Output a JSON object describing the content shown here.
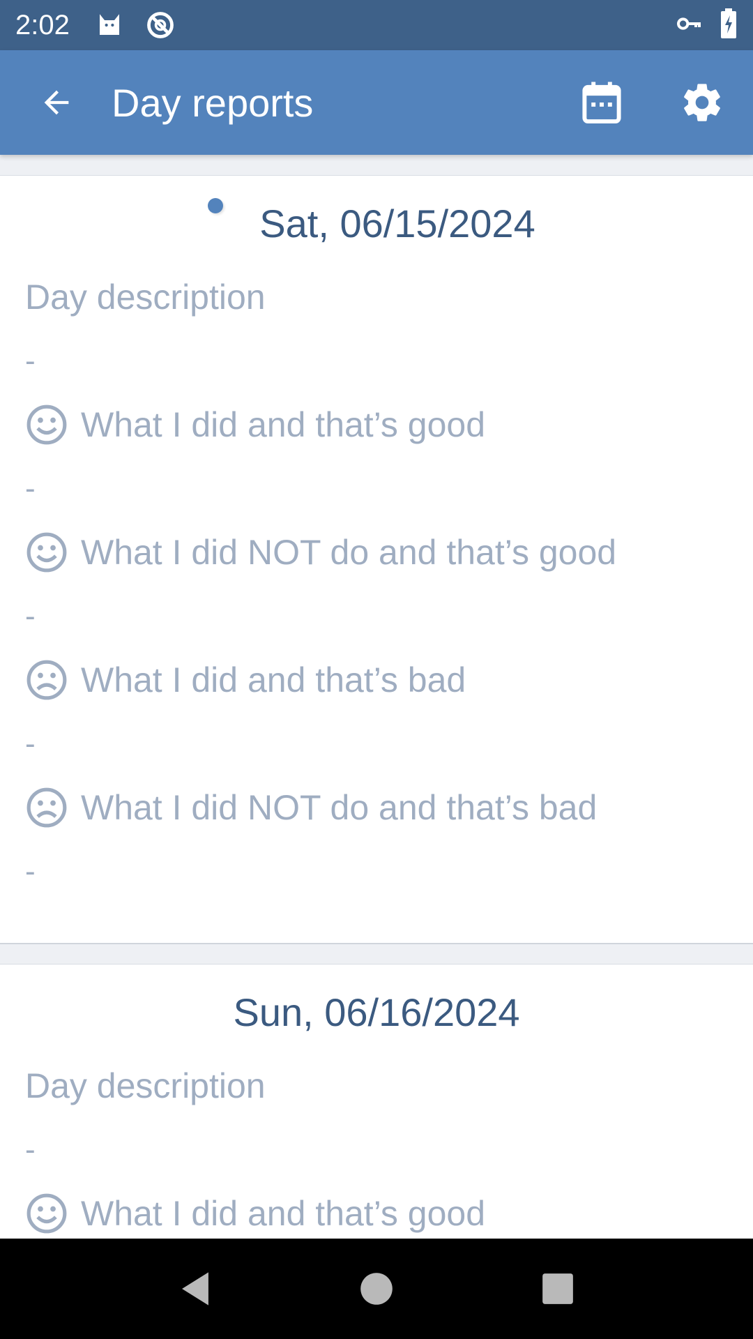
{
  "status_bar": {
    "time": "2:02",
    "icons": [
      "cat-icon",
      "no-disturb-icon",
      "vpn-key-icon",
      "battery-charging-icon"
    ]
  },
  "app_bar": {
    "title": "Day reports",
    "back_icon": "arrow-back-icon",
    "actions": [
      "calendar-icon",
      "gear-icon"
    ]
  },
  "colors": {
    "status_bar": "#3e6189",
    "app_bar": "#5383bc",
    "date_text": "#3b5a80",
    "muted_text": "#9fadc1"
  },
  "reports": [
    {
      "date": "Sat, 06/15/2024",
      "sections": [
        {
          "label": "Day description",
          "value": "-"
        },
        {
          "label": "What I did and that’s good",
          "icon": "smile-icon",
          "value": "-"
        },
        {
          "label": "What I did NOT do and that’s good",
          "icon": "smile-icon",
          "value": "-"
        },
        {
          "label": "What I did and that’s bad",
          "icon": "sad-icon",
          "value": "-"
        },
        {
          "label": "What I did NOT do and that’s bad",
          "icon": "sad-icon",
          "value": "-"
        }
      ]
    },
    {
      "date": "Sun, 06/16/2024",
      "sections": [
        {
          "label": "Day description",
          "value": "-"
        },
        {
          "label": "What I did and that’s good",
          "icon": "smile-icon",
          "value": "-"
        }
      ]
    }
  ],
  "nav_bar": [
    "back-triangle-icon",
    "home-circle-icon",
    "recents-square-icon"
  ]
}
